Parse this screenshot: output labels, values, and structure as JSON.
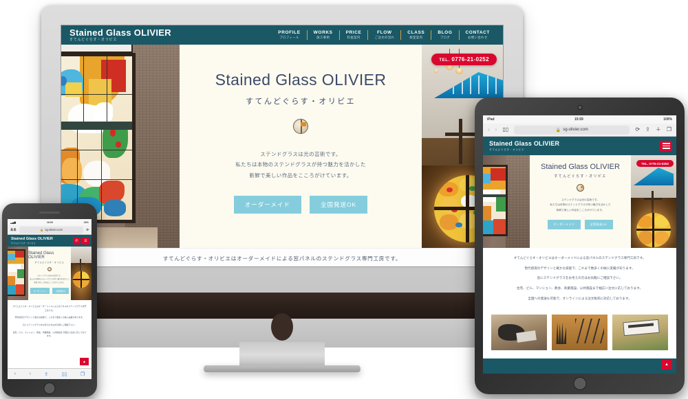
{
  "site": {
    "brand_title": "Stained Glass OLIVIER",
    "brand_sub": "すてんどぐらす・オリビエ",
    "tel_prefix": "TEL.",
    "tel_number": "0776-21-0252",
    "accent_teal": "#1a5866",
    "accent_red": "#d8082f",
    "accent_gold": "#d8a13d",
    "button_blue": "#85cddd",
    "hero_bg": "#fdfbef"
  },
  "nav": [
    {
      "en": "PROFILE",
      "jp": "プロフィール"
    },
    {
      "en": "WORKS",
      "jp": "施工事例"
    },
    {
      "en": "PRICE",
      "jp": "料金案内"
    },
    {
      "en": "FLOW",
      "jp": "ご注文の流れ"
    },
    {
      "en": "CLASS",
      "jp": "教室案内"
    },
    {
      "en": "BLOG",
      "jp": "ブログ"
    },
    {
      "en": "CONTACT",
      "jp": "お問い合わせ"
    }
  ],
  "hero": {
    "title": "Stained Glass OLIVIER",
    "subtitle": "すてんどぐらす・オリビエ",
    "line1": "ステンドグラスは光の芸術です。",
    "line2": "私たちは本物のステンドグラスが持つ魅力を活かした",
    "line3": "新鮮で美しい作品をこころがけています。",
    "btn_order": "オーダーメイド",
    "btn_ship": "全国発送OK"
  },
  "footer_line": "すてんどぐらす・オリビエはオーダーメイドによる窓パネルのステンドグラス専門工房です。",
  "body_lines": [
    "すてんどぐらす・オリビエはオーダーメイドによる窓パネルのステンドグラス専門工房です。",
    "現代感覚のデザインと確かな技能で、これまで数多くの納入実績があります。",
    "窓にステンドグラスをお考えの方はお気軽にご相談下さい。",
    "住宅、ビル、マンション、教会、商業施設、公共施設まで幅広い注文に応じております。",
    "全国への発送も可能で、オンラインによる注文販売に対応しております。"
  ],
  "phone_body_lines": [
    "すてんどぐらす・オリビエはオーダーメイドによる窓パネルのステンドグラス専門工房です。",
    "現代感覚のデザインと確かな技能で、これまで数多くの納入実績があります。",
    "窓にステンドグラスをお考えの方はお気軽にご相談下さい。",
    "住宅、ビル、マンション、教会、商業施設、公共施設まで幅広い注文に応じております。"
  ],
  "tablet": {
    "device": "iPad",
    "carrier": "iPad",
    "time": "15:59",
    "battery": "100%",
    "url": "sg-olivier.com",
    "back_icon": "chevron-left-icon",
    "forward_icon": "chevron-right-icon",
    "bookmarks_icon": "book-icon",
    "lock_icon": "lock-icon",
    "reload_icon": "reload-icon",
    "share_icon": "share-icon",
    "newtab_icon": "plus-icon",
    "tabs_icon": "tabs-icon",
    "menu_icon": "hamburger-icon",
    "back_to_top": "▲"
  },
  "phone": {
    "device": "iPhone",
    "time": "16:00",
    "battery": "26%",
    "url": "sg-olivier.com",
    "text_size_label": "ああ",
    "reload_icon": "reload-icon",
    "lock_icon": "lock-icon",
    "phone_icon": "phone-icon",
    "menu_icon": "hamburger-icon",
    "back_icon": "chevron-left-icon",
    "forward_icon": "chevron-right-icon",
    "share_icon": "share-icon",
    "bookmarks_icon": "book-icon",
    "tabs_icon": "tabs-icon",
    "back_to_top": "▲"
  },
  "thumbs": [
    {
      "name": "craftsman-hands-thumbnail"
    },
    {
      "name": "workshop-tools-thumbnail"
    },
    {
      "name": "olivier-signboard-thumbnail"
    }
  ],
  "images": {
    "left_window": "stained-glass-window-birds-squirrel",
    "right_church": "church-interior-cross-rose-window"
  }
}
